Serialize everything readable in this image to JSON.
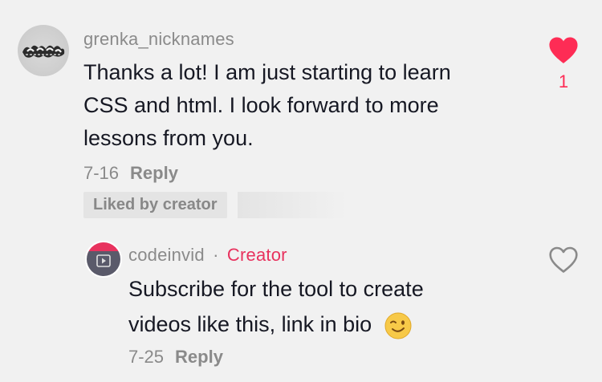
{
  "comment": {
    "username": "grenka_nicknames",
    "text_lines": [
      "Thanks a lot! I am just starting to learn",
      "CSS and html. I look forward to more",
      "lessons from you."
    ],
    "date": "7-16",
    "reply_label": "Reply",
    "liked_badge": "Liked by creator",
    "like_count": "1",
    "liked": true
  },
  "reply": {
    "username": "codeinvid",
    "separator": "·",
    "role": "Creator",
    "text_lines": [
      "Subscribe for the tool to create",
      "videos like this, link in bio"
    ],
    "emoji": "winking-face",
    "date": "7-25",
    "reply_label": "Reply",
    "liked": false
  },
  "colors": {
    "background": "#f1f1f1",
    "accent": "#fe2c55",
    "creator": "#e8325e",
    "muted": "#8a8a8a",
    "text": "#161823"
  }
}
